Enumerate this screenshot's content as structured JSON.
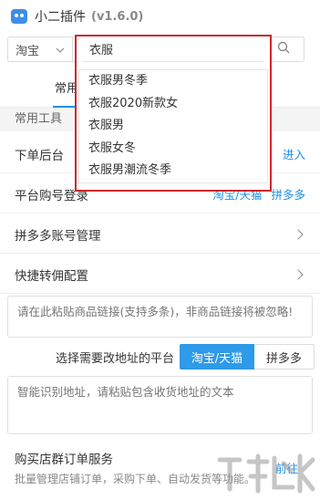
{
  "app": {
    "title": "小二插件",
    "version": "(v1.6.0)"
  },
  "search": {
    "platform": "淘宝",
    "query": "衣服"
  },
  "tabs": [
    {
      "label": "常用"
    }
  ],
  "dropdown": {
    "input_value": "衣服",
    "suggestions": [
      "衣服男冬季",
      "衣服2020新款女",
      "衣服男",
      "衣服女冬",
      "衣服男潮流冬季"
    ]
  },
  "section_header": "常用工具",
  "rows": {
    "order_backend": {
      "label": "下单后台",
      "link": "进入"
    },
    "platform_login": {
      "label": "平台购号登录",
      "link1": "淘宝/天猫",
      "link2": "拼多多"
    },
    "pdd_accounts": {
      "label": "拼多多账号管理"
    },
    "rebate_config": {
      "label": "快捷转佣配置"
    }
  },
  "paste_box": {
    "placeholder": "请在此粘贴商品链接(支持多条)，非商品链接将被忽略!"
  },
  "address": {
    "label": "选择需要改地址的平台",
    "option1": "淘宝/天猫",
    "option2": "拼多多"
  },
  "addr_box": {
    "placeholder": "智能识别地址，请粘贴包含收货地址的文本"
  },
  "group_order": {
    "title": "购买店群订单服务",
    "desc": "批量管理店铺订单，采购下单、自动发货等功能。",
    "link": "前往"
  },
  "colors": {
    "accent": "#1e8ee8",
    "highlight_border": "#d0262c"
  }
}
